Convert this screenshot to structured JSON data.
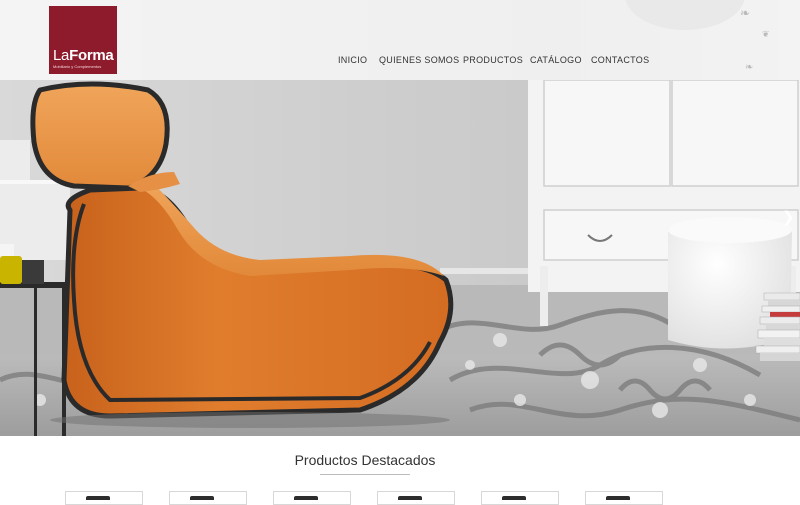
{
  "brand": {
    "name_light": "La",
    "name_bold": "Forma",
    "tagline": "Mobiliario y Complementos",
    "color": "#8e1b2b"
  },
  "nav": {
    "items": [
      {
        "label": "INICIO"
      },
      {
        "label": "QUIENES SOMOS"
      },
      {
        "label": "PRODUCTOS"
      },
      {
        "label": "CATÁLOGO"
      },
      {
        "label": "CONTACTOS"
      }
    ]
  },
  "hero": {
    "next_icon": "chevron-right-icon",
    "next_glyph": "❯"
  },
  "featured": {
    "title": "Productos Destacados",
    "thumb_count": 6
  },
  "colors": {
    "chair_orange": "#e07d2d",
    "chair_piping": "#2a2a2a",
    "wall": "#cfcfcf",
    "cabinet": "#f4f4f4"
  }
}
